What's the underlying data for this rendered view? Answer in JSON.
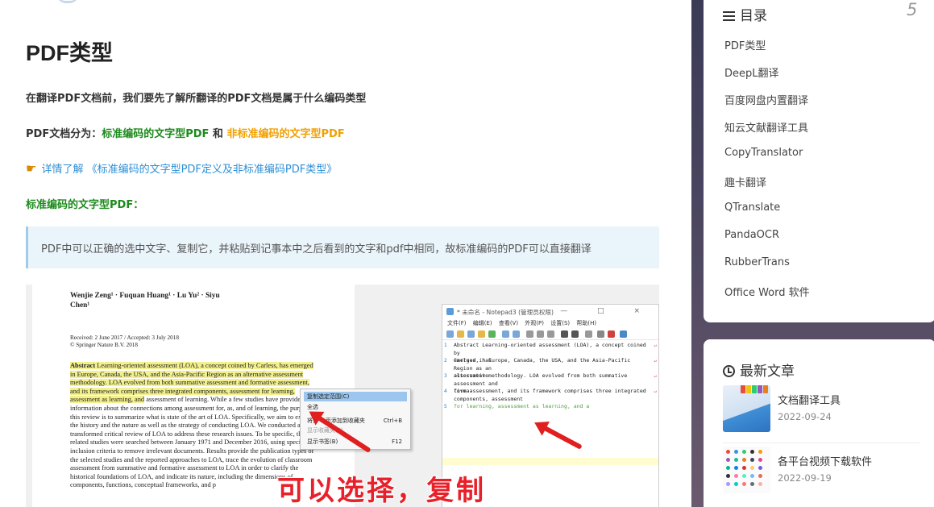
{
  "article": {
    "title": "PDF类型",
    "intro": "在翻译PDF文档前，我们要先了解所翻译的PDF文档是属于什么编码类型",
    "types_prefix": "PDF文档分为：",
    "type_standard": "标准编码的文字型PDF",
    "types_and": " 和 ",
    "type_nonstandard": "非标准编码的文字型PDF",
    "detail_link": "详情了解 《标准编码的文字型PDF定义及非标准编码PDF类型》",
    "subheading": "标准编码的文字型PDF：",
    "quote": "PDF中可以正确的选中文字、复制它，并粘贴到记事本中之后看到的文字和pdf中相同，故标准编码的PDF可以直接翻译"
  },
  "screenshot": {
    "paper": {
      "authors": "Wenjie Zeng¹ · Fuquan Huang¹ · Lu Yu² · Siyu Chen¹",
      "received": "Received: 2 June 2017 / Accepted: 3 July 2018",
      "copyright": "© Springer Nature B.V. 2018",
      "abstract_label": "Abstract",
      "abstract_selected": "Learning-oriented assessment (LOA), a concept coined by Carless, has emerged in Europe, Canada, the USA, and the Asia-Pacific Region as an alternative assessment methodology. LOA evolved from both summative assessment and formative assessment, and its framework comprises three integrated components, assessment for learning, assessment as learning, and",
      "abstract_rest": "assessment of learning. While a few studies have provided information about the connections among assessment for, as, and of learning, the purpose of this review is to summarize what is state of the art of LOA. Specifically, we aim to examine the history and the nature as well as the strategy of conducting LOA. We conducted a transformed critical review of LOA to address these research issues. To be specific, the related studies were searched between January 1971 and December 2016, using specific inclusion criteria to remove irrelevant documents. Results provide the publication types of the selected studies and the reported approaches to LOA, trace the evolution of classroom assessment from summative and formative assessment to LOA in order to clarify the historical foundations of LOA, and indicate its nature, including the dimensions of components, functions, conceptual frameworks, and p"
    },
    "context_menu": {
      "items": [
        {
          "label": "复制选定范围(C)",
          "key": ""
        },
        {
          "label": "全选",
          "key": ""
        },
        {
          "label": "将第 1 页添加到收藏夹",
          "key": "Ctrl+B"
        },
        {
          "label": "显示收藏夹(F)",
          "key": ""
        },
        {
          "label": "显示书签(B)",
          "key": "F12"
        }
      ]
    },
    "notepad": {
      "title": "* 未命名 - Notepad3 (管理员权限)",
      "window_controls": "— □ ×",
      "menu": "文件(F) 编辑(E) 查看(V) 外观(P) 设置(S) 帮助(H)",
      "lines": [
        {
          "n": "1",
          "text": "Abstract Learning-oriented assessment (LOA), a concept coined by\nCarless, has"
        },
        {
          "n": "2",
          "text": "emerged in Europe, Canada, the USA, and the Asia-Pacific Region as an\nalternative"
        },
        {
          "n": "3",
          "text": "assessment methodology. LOA evolved from both summative assessment and\nforma-"
        },
        {
          "n": "4",
          "text": "tive assessment, and its framework comprises three integrated\ncomponents, assessment"
        },
        {
          "n": "5",
          "text": "for learning, assessment as learning, and a"
        }
      ]
    },
    "caption": "可以选择，复制"
  },
  "sidebar": {
    "toc": {
      "heading": "目录",
      "count": "5",
      "items": [
        "PDF类型",
        "DeepL翻译",
        "百度网盘内置翻译",
        "知云文献翻译工具",
        "CopyTranslator",
        "趣卡翻译",
        "QTranslate",
        "PandaOCR",
        "RubberTrans",
        "Office Word 软件"
      ]
    },
    "recent": {
      "heading": "最新文章",
      "posts": [
        {
          "title": "文档翻译工具",
          "date": "2022-09-24"
        },
        {
          "title": "各平台视频下载软件",
          "date": "2022-09-19"
        }
      ]
    }
  },
  "colors": {
    "green": "#1c8a1c",
    "orange": "#f0a000",
    "link": "#2d8fd5",
    "quote_bg": "#eaf4fb",
    "caption_red": "#e8202a"
  }
}
